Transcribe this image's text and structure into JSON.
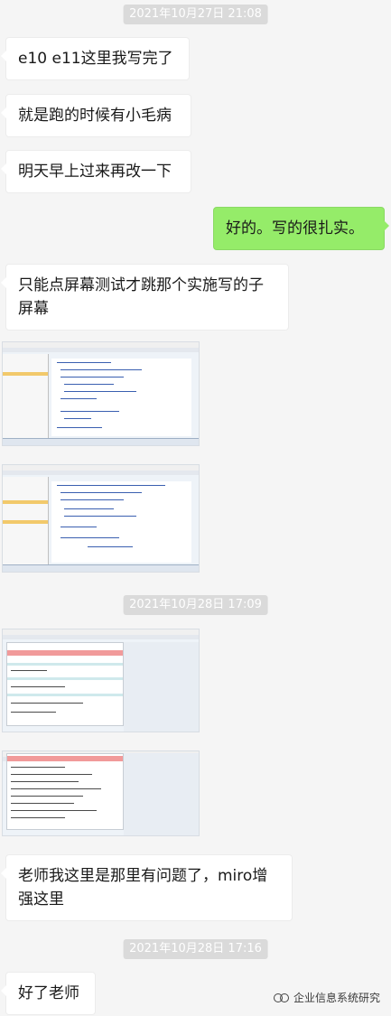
{
  "timestamps": {
    "t1": "2021年10月27日 21:08",
    "t2": "2021年10月28日 17:09",
    "t3": "2021年10月28日 17:16"
  },
  "messages": {
    "m1": "e10 e11这里我写完了",
    "m2": "就是跑的时候有小毛病",
    "m3": "明天早上过来再改一下",
    "m4": "好的。写的很扎实。",
    "m5": "只能点屏幕测试才跳那个实施写的子屏幕",
    "m6": "老师我这里是那里有问题了，miro增强这里",
    "m7": "好了老师"
  },
  "watermark": {
    "text": "企业信息系统研究",
    "icon": "wechat-channel-icon"
  },
  "colors": {
    "background": "#f5f5f5",
    "self_bubble": "#95ec69",
    "other_bubble": "#ffffff",
    "timestamp_bg": "#dadada"
  }
}
